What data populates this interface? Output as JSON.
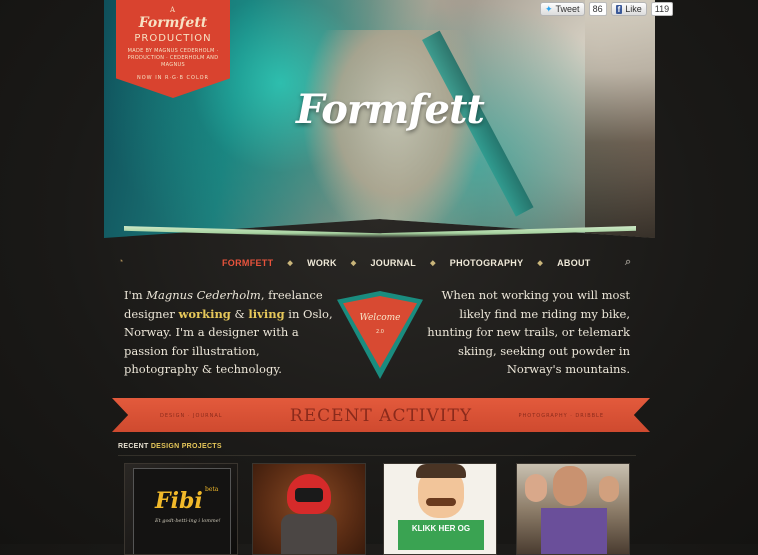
{
  "hero": {
    "logo": "Formfett",
    "badge": {
      "line1": "A",
      "brand": "Formfett",
      "production": "PRODUCTION",
      "credits": "MADE BY MAGNUS CEDERHOLM · PRODUCTION · CEDERHOLM AND MAGNUS",
      "footer": "NOW IN R·G·B COLOR"
    }
  },
  "social": {
    "tweet_label": "Tweet",
    "tweet_count": "86",
    "like_label": "Like",
    "like_count": "119"
  },
  "nav": {
    "items": [
      {
        "label": "FORMFETT",
        "active": true
      },
      {
        "label": "WORK"
      },
      {
        "label": "JOURNAL"
      },
      {
        "label": "PHOTOGRAPHY"
      },
      {
        "label": "ABOUT"
      }
    ]
  },
  "intro": {
    "left_prefix": "I'm ",
    "name": "Magnus Cederholm",
    "left_mid": ", freelance designer ",
    "working": "working",
    "amp": " & ",
    "living": "living",
    "left_suffix": " in Oslo, Norway. I'm a designer with a passion for illustration, photography & technology.",
    "right": "When not working you will most likely find me riding my bike, hunting for new trails, or telemark skiing, seeking out powder in Norway's mountains."
  },
  "welcome": {
    "text": "Welcome",
    "version": "2.0"
  },
  "ribbon": {
    "title": "RECENT ACTIVITY",
    "left_links": "DESIGN · JOURNAL",
    "right_links": "PHOTOGRAPHY · DRIBBLE"
  },
  "projects": {
    "heading_prefix": "RECENT ",
    "heading_accent": "DESIGN PROJECTS",
    "thumbs": [
      {
        "title": "Fibi",
        "badge": "beta",
        "tagline": "Et godt-betti-ing i lomme!"
      },
      {
        "title": "Helmet character"
      },
      {
        "sign": "KLIKK HER OG"
      },
      {
        "title": "Group photo"
      }
    ]
  }
}
